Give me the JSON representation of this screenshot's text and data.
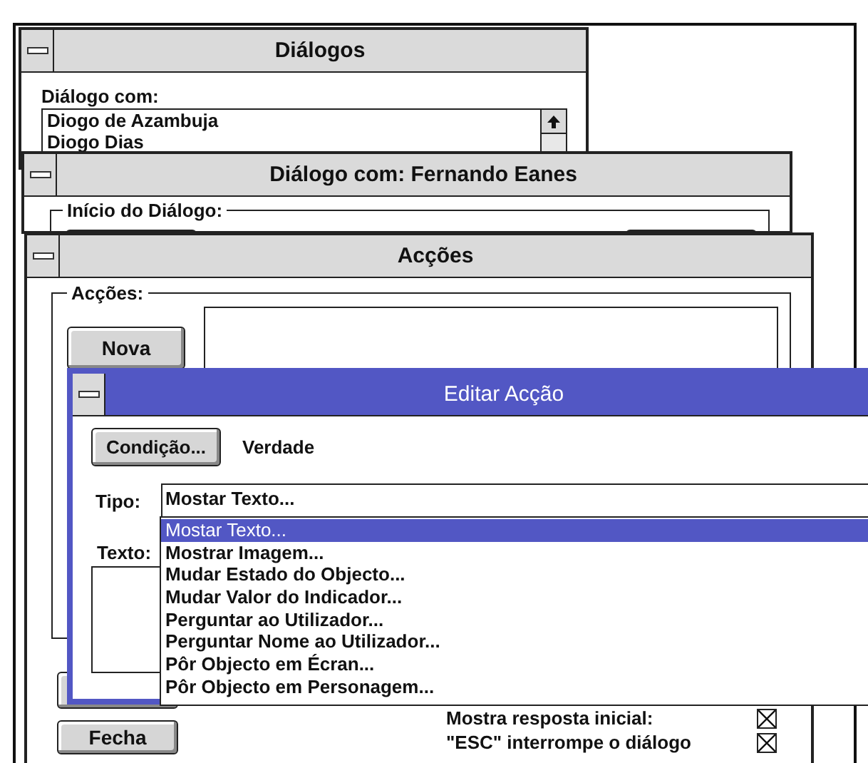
{
  "windows": [
    {
      "kind": "dialogs",
      "title": "Diálogos",
      "active": false,
      "list_label": "Diálogo com:",
      "list_items": [
        "Diogo de Azambuja",
        "Diogo Dias"
      ]
    },
    {
      "kind": "conversation",
      "title": "Diálogo com: Fernando Eanes",
      "active": false,
      "group_label": "Início do Diálogo:"
    },
    {
      "kind": "actions",
      "title": "Acções",
      "active": false,
      "group_label": "Acções:",
      "new_button": "Nova",
      "close_button": "Fecha",
      "options": [
        {
          "label": "Mostra resposta inicial:",
          "checked": true
        },
        {
          "label": "\"ESC\" interrompe o diálogo",
          "checked": true
        }
      ]
    },
    {
      "kind": "edit_action",
      "title": "Editar Acção",
      "active": true,
      "condition_button": "Condição...",
      "condition": "Verdade",
      "type_label": "Tipo:",
      "type_value": "Mostar Texto...",
      "text_label": "Texto:",
      "type_options": [
        {
          "label": "Mostar Texto...",
          "selected": true
        },
        {
          "label": "Mostrar Imagem...",
          "selected": false
        },
        {
          "label": "Mudar Estado do Objecto...",
          "selected": false
        },
        {
          "label": "Mudar Valor do Indicador...",
          "selected": false
        },
        {
          "label": "Perguntar ao Utilizador...",
          "selected": false
        },
        {
          "label": "Perguntar Nome ao Utilizador...",
          "selected": false
        },
        {
          "label": "Pôr Objecto em Écran...",
          "selected": false
        },
        {
          "label": "Pôr Objecto em Personagem...",
          "selected": false
        }
      ]
    }
  ]
}
